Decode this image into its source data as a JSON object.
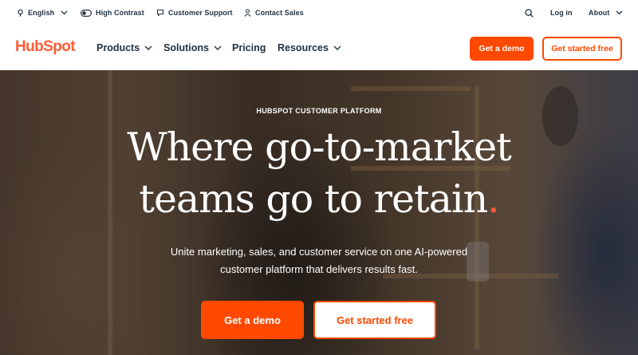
{
  "utility_bar": {
    "language": "English",
    "high_contrast": "High Contrast",
    "customer_support": "Customer Support",
    "contact_sales": "Contact Sales",
    "login": "Log in",
    "about": "About"
  },
  "nav": {
    "logo_text": "HubSpot",
    "items": [
      {
        "label": "Products",
        "has_dropdown": true
      },
      {
        "label": "Solutions",
        "has_dropdown": true
      },
      {
        "label": "Pricing",
        "has_dropdown": false
      },
      {
        "label": "Resources",
        "has_dropdown": true
      }
    ],
    "demo_button": "Get a demo",
    "started_button": "Get started free"
  },
  "hero": {
    "eyebrow": "HUBSPOT CUSTOMER PLATFORM",
    "title_line1": "Where go-to-market",
    "title_line2": "teams go to retain",
    "title_dot": ".",
    "subtitle_line1": "Unite marketing, sales, and customer service on one AI-powered",
    "subtitle_line2": "customer platform that delivers results fast.",
    "demo_button": "Get a demo",
    "started_button": "Get started free"
  },
  "colors": {
    "brand_orange": "#ff4800",
    "logo_orange": "#ff5c35",
    "text_dark": "#213343"
  },
  "icons": [
    "globe-icon",
    "contrast-toggle-icon",
    "chat-bubble-icon",
    "person-icon",
    "search-icon",
    "chevron-down-icon"
  ]
}
